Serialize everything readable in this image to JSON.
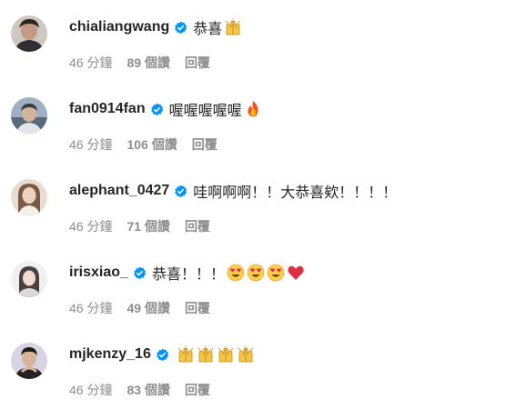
{
  "comments": [
    {
      "username": "chialiangwang",
      "text": "恭喜",
      "emojis": [
        "raising-hands"
      ],
      "time": "46 分鐘",
      "likes": "89 個讚",
      "reply": "回覆"
    },
    {
      "username": "fan0914fan",
      "text": "喔喔喔喔喔",
      "emojis": [
        "fire"
      ],
      "time": "46 分鐘",
      "likes": "106 個讚",
      "reply": "回覆"
    },
    {
      "username": "alephant_0427",
      "text": "哇啊啊啊！！大恭喜欸！！！！",
      "emojis": [],
      "time": "46 分鐘",
      "likes": "71 個讚",
      "reply": "回覆"
    },
    {
      "username": "irisxiao_",
      "text": "恭喜！！！",
      "emojis": [
        "heart-eyes",
        "heart-eyes",
        "heart-eyes",
        "red-heart"
      ],
      "time": "46 分鐘",
      "likes": "49 個讚",
      "reply": "回覆"
    },
    {
      "username": "mjkenzy_16",
      "text": "",
      "emojis": [
        "raising-hands",
        "raising-hands",
        "raising-hands",
        "raising-hands"
      ],
      "time": "46 分鐘",
      "likes": "83 個讚",
      "reply": "回覆"
    }
  ],
  "colors": {
    "verified": "#0095f6",
    "meta": "#8e8e8e",
    "username": "#262626"
  }
}
